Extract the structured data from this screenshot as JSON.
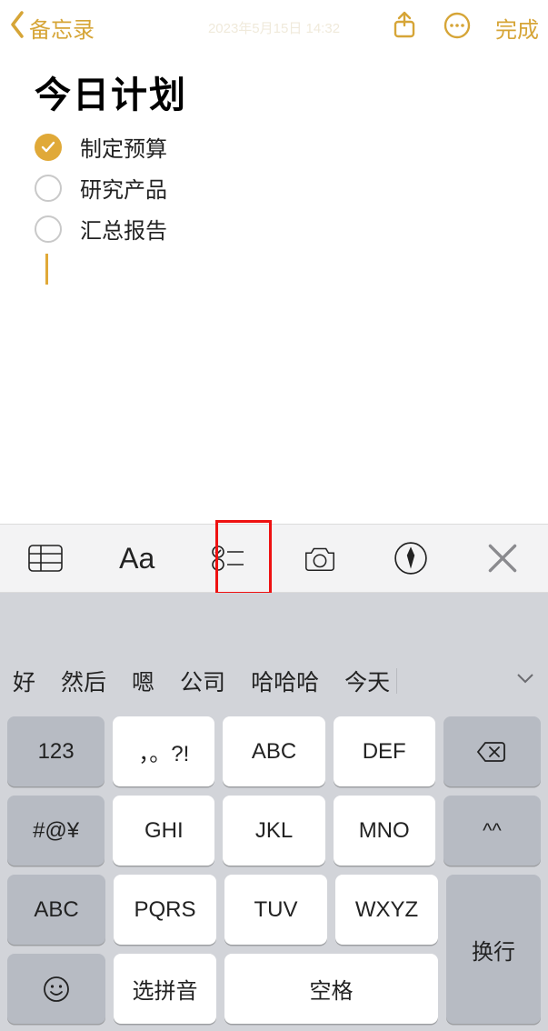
{
  "nav": {
    "back_label": "备忘录",
    "date": "2023年5月15日 14:32",
    "done_label": "完成"
  },
  "note": {
    "title": "今日计划",
    "items": [
      {
        "text": "制定预算",
        "checked": true
      },
      {
        "text": "研究产品",
        "checked": false
      },
      {
        "text": "汇总报告",
        "checked": false
      }
    ]
  },
  "format_toolbar": {
    "aa": "Aa"
  },
  "keyboard": {
    "candidates": [
      "好",
      "然后",
      "嗯",
      "公司",
      "哈哈哈",
      "今天"
    ],
    "keys": {
      "num": "123",
      "punct": "，。?!",
      "abc": "ABC",
      "def": "DEF",
      "sym": "#@¥",
      "ghi": "GHI",
      "jkl": "JKL",
      "mno": "MNO",
      "face": "^^",
      "mode": "ABC",
      "pqrs": "PQRS",
      "tuv": "TUV",
      "wxyz": "WXYZ",
      "return": "换行",
      "pinyin": "选拼音",
      "space": "空格"
    }
  }
}
